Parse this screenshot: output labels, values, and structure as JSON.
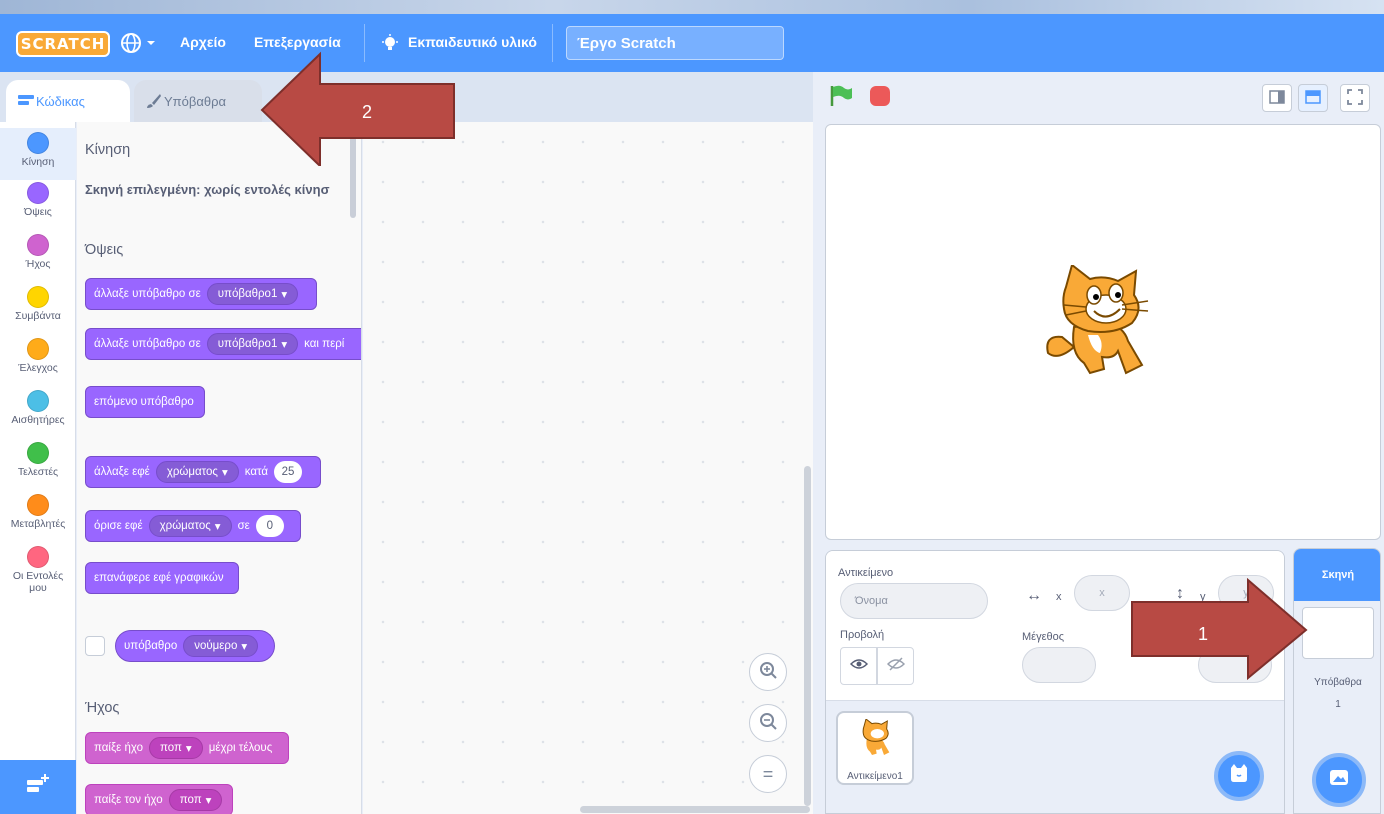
{
  "menubar": {
    "logo": "SCRATCH",
    "language_icon": "globe-icon",
    "file": "Αρχείο",
    "edit": "Επεξεργασία",
    "tutorials": "Εκπαιδευτικό υλικό",
    "project_title": "Έργο Scratch"
  },
  "tabs": {
    "code": "Κώδικας",
    "backdrops": "Υπόβαθρα"
  },
  "categories": [
    {
      "label": "Κίνηση",
      "color": "#4c97ff"
    },
    {
      "label": "Όψεις",
      "color": "#9966ff"
    },
    {
      "label": "Ήχος",
      "color": "#cf63cf"
    },
    {
      "label": "Συμβάντα",
      "color": "#ffd500"
    },
    {
      "label": "Έλεγχος",
      "color": "#ffab19"
    },
    {
      "label": "Αισθητήρες",
      "color": "#4cbfe6"
    },
    {
      "label": "Τελεστές",
      "color": "#40bf4a"
    },
    {
      "label": "Μεταβλητές",
      "color": "#ff8c1a"
    },
    {
      "label": "Οι Εντολές",
      "label2": "μου",
      "color": "#ff6680"
    }
  ],
  "palette": {
    "motion_heading": "Κίνηση",
    "motion_note": "Σκηνή επιλεγμένη: χωρίς εντολές κίνησ",
    "looks_heading": "Όψεις",
    "switch_backdrop": "άλλαξε υπόβαθρο σε",
    "backdrop1": "υπόβαθρο1",
    "switch_backdrop_wait_suffix": "και περί",
    "next_backdrop": "επόμενο υπόβαθρο",
    "change_effect": "άλλαξε εφέ",
    "color_effect": "χρώματος",
    "by": "κατά",
    "by_value": "25",
    "set_effect": "όρισε εφέ",
    "to": "σε",
    "to_value": "0",
    "clear_effects": "επανάφερε εφέ γραφικών",
    "backdrop_reporter": "υπόβαθρο",
    "number": "νούμερο",
    "sound_heading": "Ήχος",
    "play_sound_until_done": "παίξε ήχο",
    "pop": "ποπ",
    "until_done": "μέχρι τέλους",
    "start_sound": "παίξε τον ήχο"
  },
  "sprite_info": {
    "sprite_label": "Αντικείμενο",
    "name_placeholder": "Όνομα",
    "x_label": "x",
    "x_placeholder": "x",
    "y_label": "y",
    "y_placeholder": "y",
    "show_label": "Προβολή",
    "size_label": "Μέγεθος"
  },
  "sprites": [
    {
      "name": "Αντικείμενο1"
    }
  ],
  "stage_panel": {
    "title": "Σκηνή",
    "backdrops_label": "Υπόβαθρα",
    "backdrops_count": "1"
  },
  "annotations": {
    "arrow1": "1",
    "arrow2": "2",
    "arrow_color": "#b84a44"
  }
}
